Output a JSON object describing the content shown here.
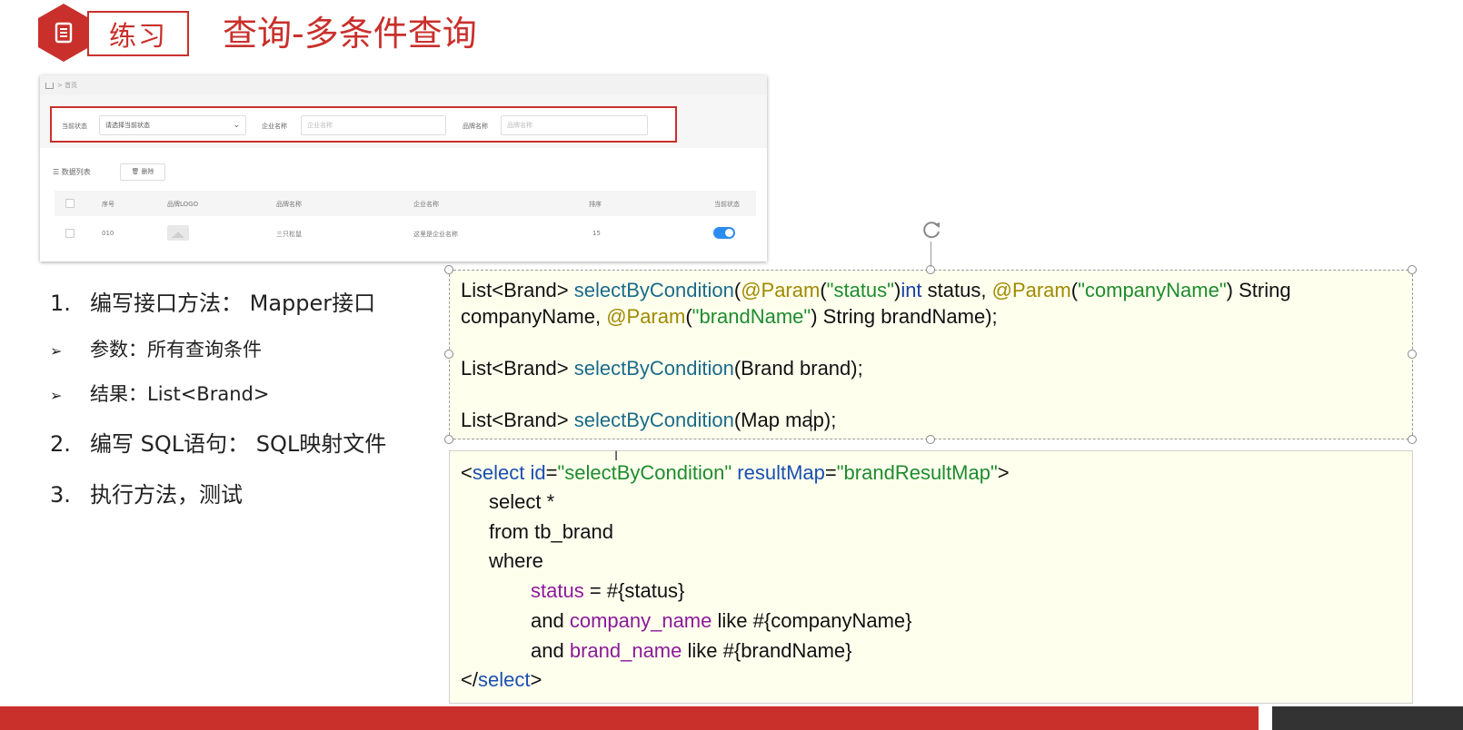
{
  "header": {
    "tag": "练习",
    "title": "查询-多条件查询"
  },
  "app": {
    "breadcrumb": "首页",
    "filters": {
      "status_label": "当前状态",
      "status_value": "请选择当前状态",
      "company_label": "企业名称",
      "company_placeholder": "企业名称",
      "brand_label": "品牌名称",
      "brand_placeholder": "品牌名称"
    },
    "list_title": "数据列表",
    "delete_label": "删除",
    "columns": [
      "序号",
      "品牌LOGO",
      "品牌名称",
      "企业名称",
      "排序",
      "当前状态"
    ],
    "rows": [
      {
        "id": "010",
        "brand_name": "三只松鼠",
        "company_name": "这里是企业名称",
        "order": "15",
        "status_on": true
      }
    ],
    "colors": {
      "toggle": "#2b8cf0",
      "highlight": "#c9302c"
    }
  },
  "steps": [
    {
      "num": "1.",
      "text": "编写接口方法： Mapper接口"
    },
    {
      "bullet": "➢",
      "text": "参数：所有查询条件"
    },
    {
      "bullet": "➢",
      "text": "结果：List<Brand>"
    },
    {
      "num": "2.",
      "text": "编写 SQL语句： SQL映射文件"
    },
    {
      "num": "3.",
      "text": "执行方法，测试"
    }
  ],
  "code1": {
    "l1": [
      "List<Brand> ",
      "selectByCondition",
      "(",
      "@Param",
      "(",
      "\"status\"",
      ")",
      "int",
      " status, ",
      "@Param",
      "(",
      "\"companyName\"",
      ") String"
    ],
    "l2": [
      "companyName, ",
      "@Param",
      "(",
      "\"brandName\"",
      ") String brandName);"
    ],
    "l3": [
      "List<Brand> ",
      "selectByCondition",
      "(Brand brand);"
    ],
    "l4": [
      "List<Brand> ",
      "selectByCondition",
      "(Map ",
      "map);"
    ]
  },
  "code2": {
    "l1": [
      "<",
      "select",
      " ",
      "id",
      "=",
      "\"selectByCondition\"",
      " ",
      "resultMap",
      "=",
      "\"brandResultMap\"",
      ">"
    ],
    "l2": "select *",
    "l3": "from tb_brand",
    "l4": "where",
    "l5": [
      "status",
      " = #{status}"
    ],
    "l6": [
      "and ",
      "company_name",
      " like #{companyName}"
    ],
    "l7": [
      "and ",
      "brand_name",
      " like #{brandName}"
    ],
    "l8": [
      "</",
      "select",
      ">"
    ]
  },
  "icons": {
    "tag_icon": "document-icon",
    "rotate": "rotate-handle-icon",
    "home": "home-icon",
    "list": "list-icon",
    "delete": "trash-icon"
  }
}
